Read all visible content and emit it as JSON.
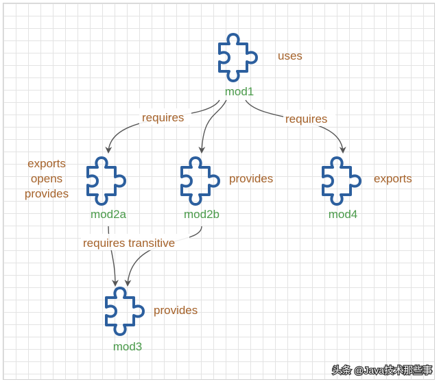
{
  "modules": {
    "mod1": "mod1",
    "mod2a": "mod2a",
    "mod2b": "mod2b",
    "mod3": "mod3",
    "mod4": "mod4"
  },
  "directives": {
    "mod1": [
      "uses"
    ],
    "mod2a": [
      "exports",
      "opens",
      "provides"
    ],
    "mod2b": [
      "provides"
    ],
    "mod3": [
      "provides"
    ],
    "mod4": [
      "exports"
    ]
  },
  "edges": [
    {
      "from": "mod1",
      "to": "mod2a",
      "label": "requires"
    },
    {
      "from": "mod1",
      "to": "mod2b",
      "label": ""
    },
    {
      "from": "mod1",
      "to": "mod4",
      "label": "requires"
    },
    {
      "from": "mod2a",
      "to": "mod3",
      "label": "requires transitive"
    },
    {
      "from": "mod2b",
      "to": "mod3",
      "label": ""
    }
  ],
  "colors": {
    "module_label": "#4a9a4a",
    "directive_label": "#a5622a",
    "puzzle_stroke": "#2c5f9e",
    "arrow": "#555555",
    "grid": "#e3e3e3"
  },
  "icon": "puzzle-piece-icon",
  "watermark": "头条 @Java技术那些事"
}
